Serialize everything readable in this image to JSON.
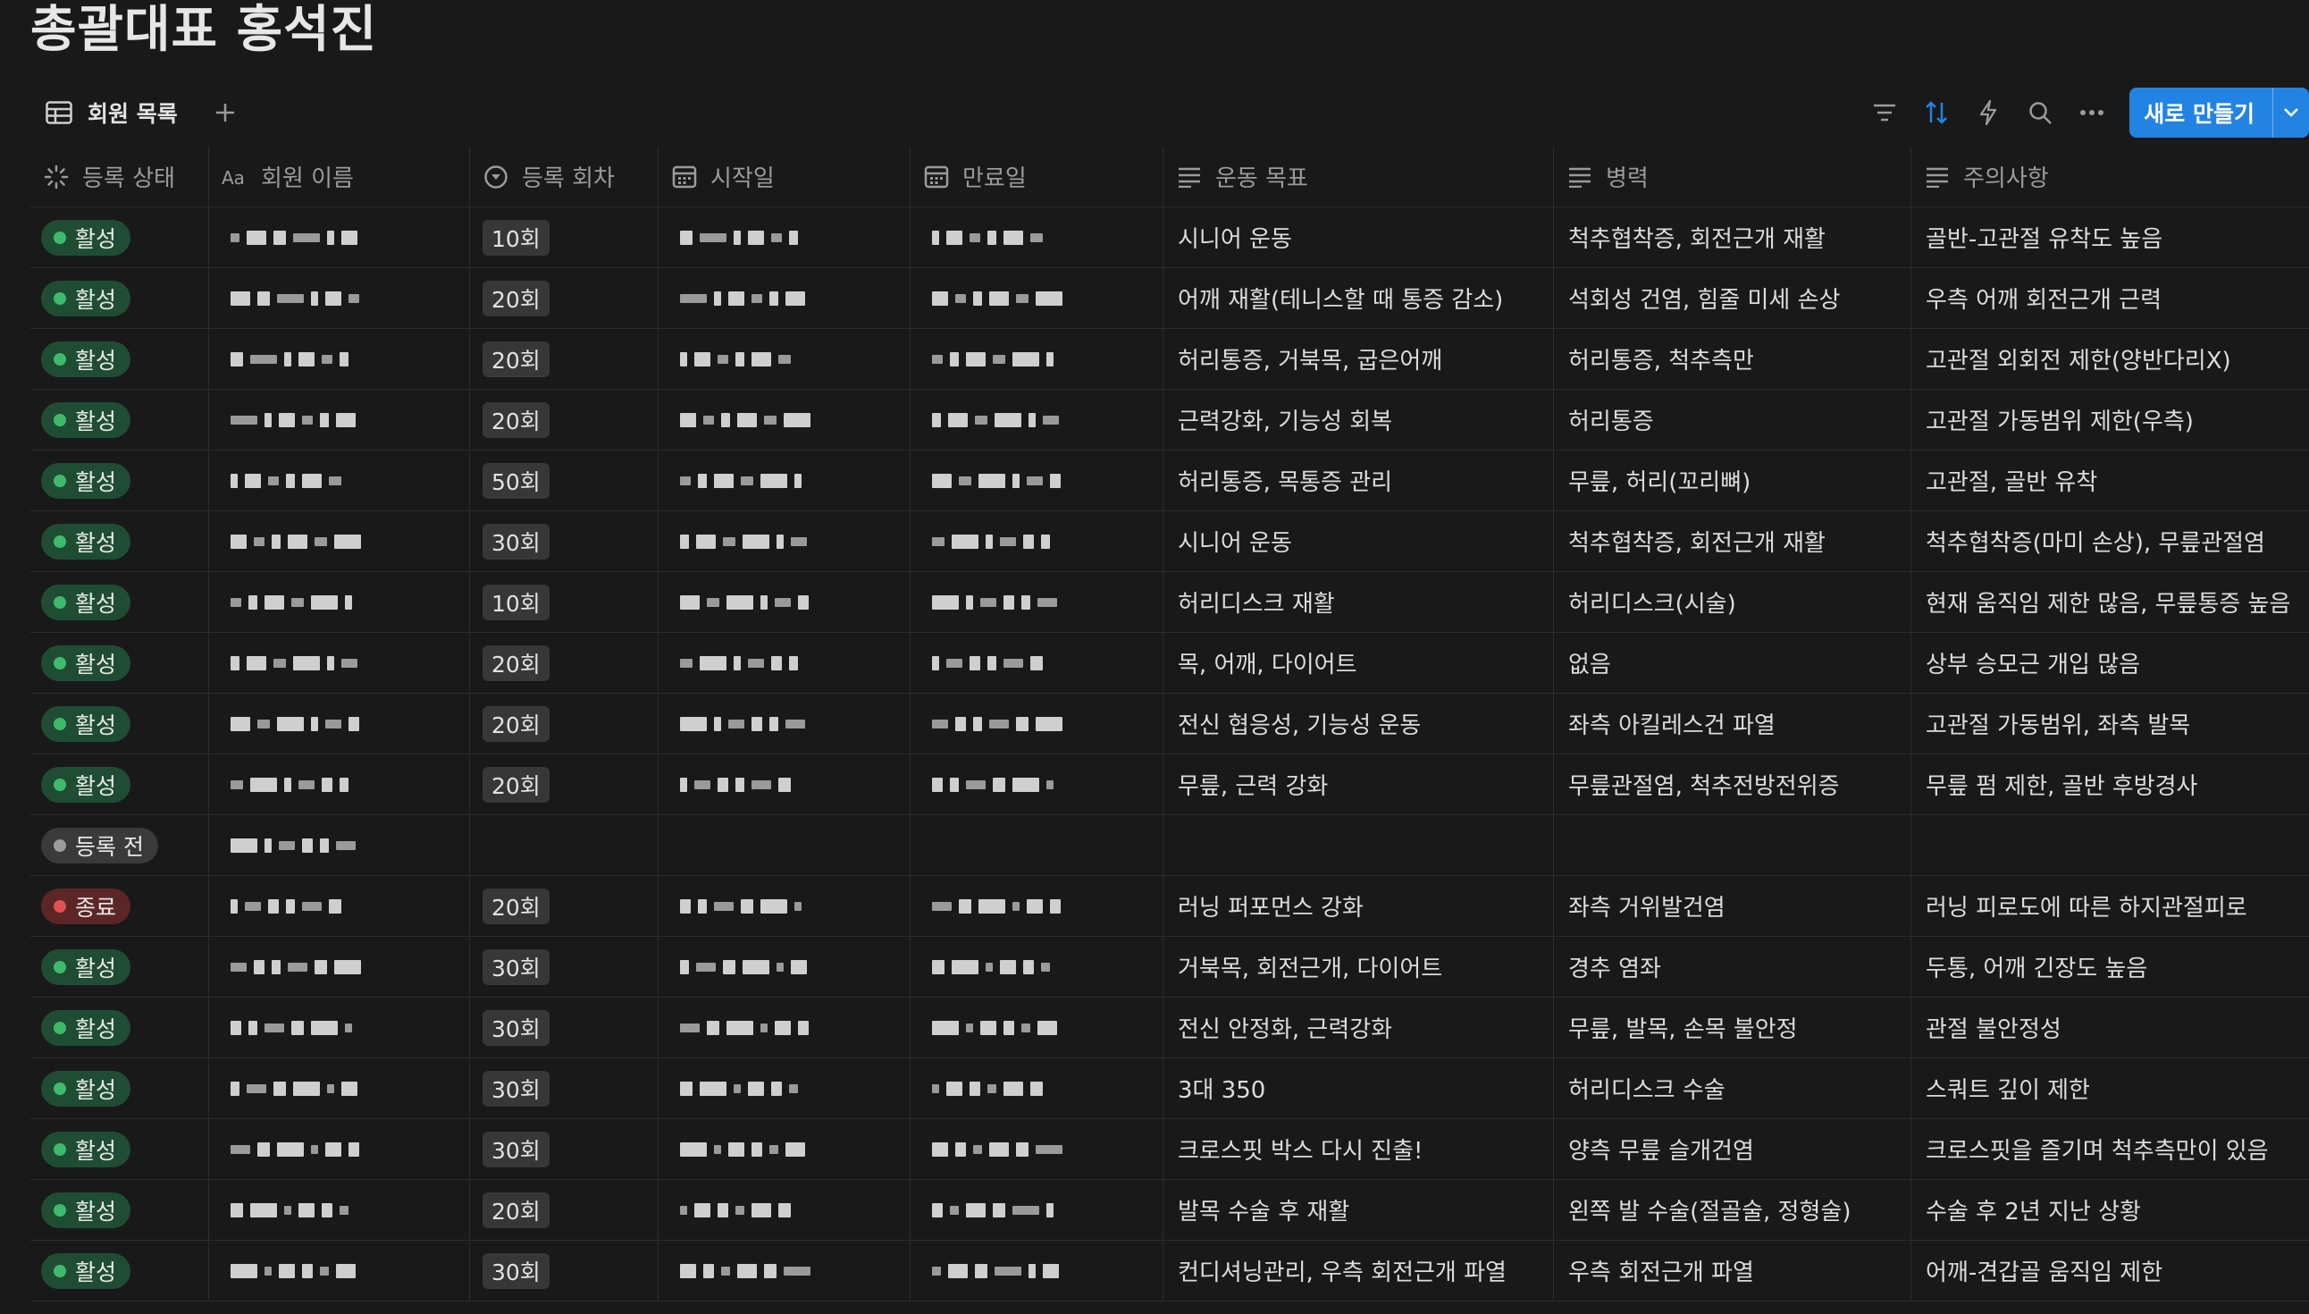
{
  "page": {
    "title": "총괄대표 홍석진"
  },
  "view": {
    "tab_label": "회원 목록"
  },
  "toolbar": {
    "new_button_label": "새로 만들기",
    "icons": [
      "filter-icon",
      "sort-icon",
      "automation-bolt-icon",
      "search-icon",
      "more-icon",
      "chevron-down-icon"
    ],
    "accent_color": "#2383e2"
  },
  "columns": [
    {
      "label": "등록 상태",
      "icon": "status-icon"
    },
    {
      "label": "회원 이름",
      "icon": "text-type-icon"
    },
    {
      "label": "등록 회차",
      "icon": "select-icon"
    },
    {
      "label": "시작일",
      "icon": "calendar-icon"
    },
    {
      "label": "만료일",
      "icon": "calendar-icon"
    },
    {
      "label": "운동 목표",
      "icon": "text-lines-icon"
    },
    {
      "label": "병력",
      "icon": "text-lines-icon"
    },
    {
      "label": "주의사항",
      "icon": "text-lines-icon"
    }
  ],
  "status_colors": {
    "활성": "#3fb96c",
    "등록 전": "#9b9b9b",
    "종료": "#e05252"
  },
  "rows": [
    {
      "status": "활성",
      "count": "10회",
      "goal": "시니어 운동",
      "history": "척추협착증, 회전근개 재활",
      "caution": "골반-고관절 유착도 높음"
    },
    {
      "status": "활성",
      "count": "20회",
      "goal": "어깨 재활(테니스할 때 통증 감소)",
      "history": "석회성 건염, 힘줄 미세 손상",
      "caution": "우측 어깨 회전근개 근력"
    },
    {
      "status": "활성",
      "count": "20회",
      "goal": "허리통증, 거북목, 굽은어깨",
      "history": "허리통증, 척추측만",
      "caution": "고관절 외회전 제한(양반다리X)"
    },
    {
      "status": "활성",
      "count": "20회",
      "goal": "근력강화, 기능성 회복",
      "history": "허리통증",
      "caution": "고관절 가동범위 제한(우측)"
    },
    {
      "status": "활성",
      "count": "50회",
      "goal": "허리통증, 목통증 관리",
      "history": "무릎, 허리(꼬리뼈)",
      "caution": "고관절, 골반 유착"
    },
    {
      "status": "활성",
      "count": "30회",
      "goal": "시니어 운동",
      "history": "척추협착증, 회전근개 재활",
      "caution": "척추협착증(마미 손상), 무릎관절염"
    },
    {
      "status": "활성",
      "count": "10회",
      "goal": "허리디스크 재활",
      "history": "허리디스크(시술)",
      "caution": "현재 움직임 제한 많음, 무릎통증 높음"
    },
    {
      "status": "활성",
      "count": "20회",
      "goal": "목, 어깨, 다이어트",
      "history": "없음",
      "caution": "상부 승모근 개입 많음"
    },
    {
      "status": "활성",
      "count": "20회",
      "goal": "전신 협응성, 기능성 운동",
      "history": "좌측 아킬레스건 파열",
      "caution": "고관절 가동범위, 좌측 발목"
    },
    {
      "status": "활성",
      "count": "20회",
      "goal": "무릎, 근력 강화",
      "history": "무릎관절염, 척추전방전위증",
      "caution": "무릎 펌 제한, 골반 후방경사"
    },
    {
      "status": "등록 전",
      "count": "",
      "goal": "",
      "history": "",
      "caution": ""
    },
    {
      "status": "종료",
      "count": "20회",
      "goal": "러닝 퍼포먼스 강화",
      "history": "좌측 거위발건염",
      "caution": "러닝 피로도에 따른 하지관절피로"
    },
    {
      "status": "활성",
      "count": "30회",
      "goal": "거북목, 회전근개, 다이어트",
      "history": "경추 염좌",
      "caution": "두통, 어깨 긴장도 높음"
    },
    {
      "status": "활성",
      "count": "30회",
      "goal": "전신 안정화, 근력강화",
      "history": "무릎, 발목, 손목 불안정",
      "caution": "관절 불안정성"
    },
    {
      "status": "활성",
      "count": "30회",
      "goal": "3대 350",
      "history": "허리디스크 수술",
      "caution": "스쿼트 깊이 제한"
    },
    {
      "status": "활성",
      "count": "30회",
      "goal": "크로스핏 박스 다시 진출!",
      "history": "양측 무릎 슬개건염",
      "caution": "크로스핏을 즐기며 척추측만이 있음"
    },
    {
      "status": "활성",
      "count": "20회",
      "goal": "발목 수술 후 재활",
      "history": "왼쪽 발 수술(절골술, 정형술)",
      "caution": "수술 후 2년 지난 상황"
    },
    {
      "status": "활성",
      "count": "30회",
      "goal": "컨디셔닝관리, 우측 회전근개 파열",
      "history": "우측 회전근개 파열",
      "caution": "어깨-견갑골 움직임 제한"
    }
  ]
}
